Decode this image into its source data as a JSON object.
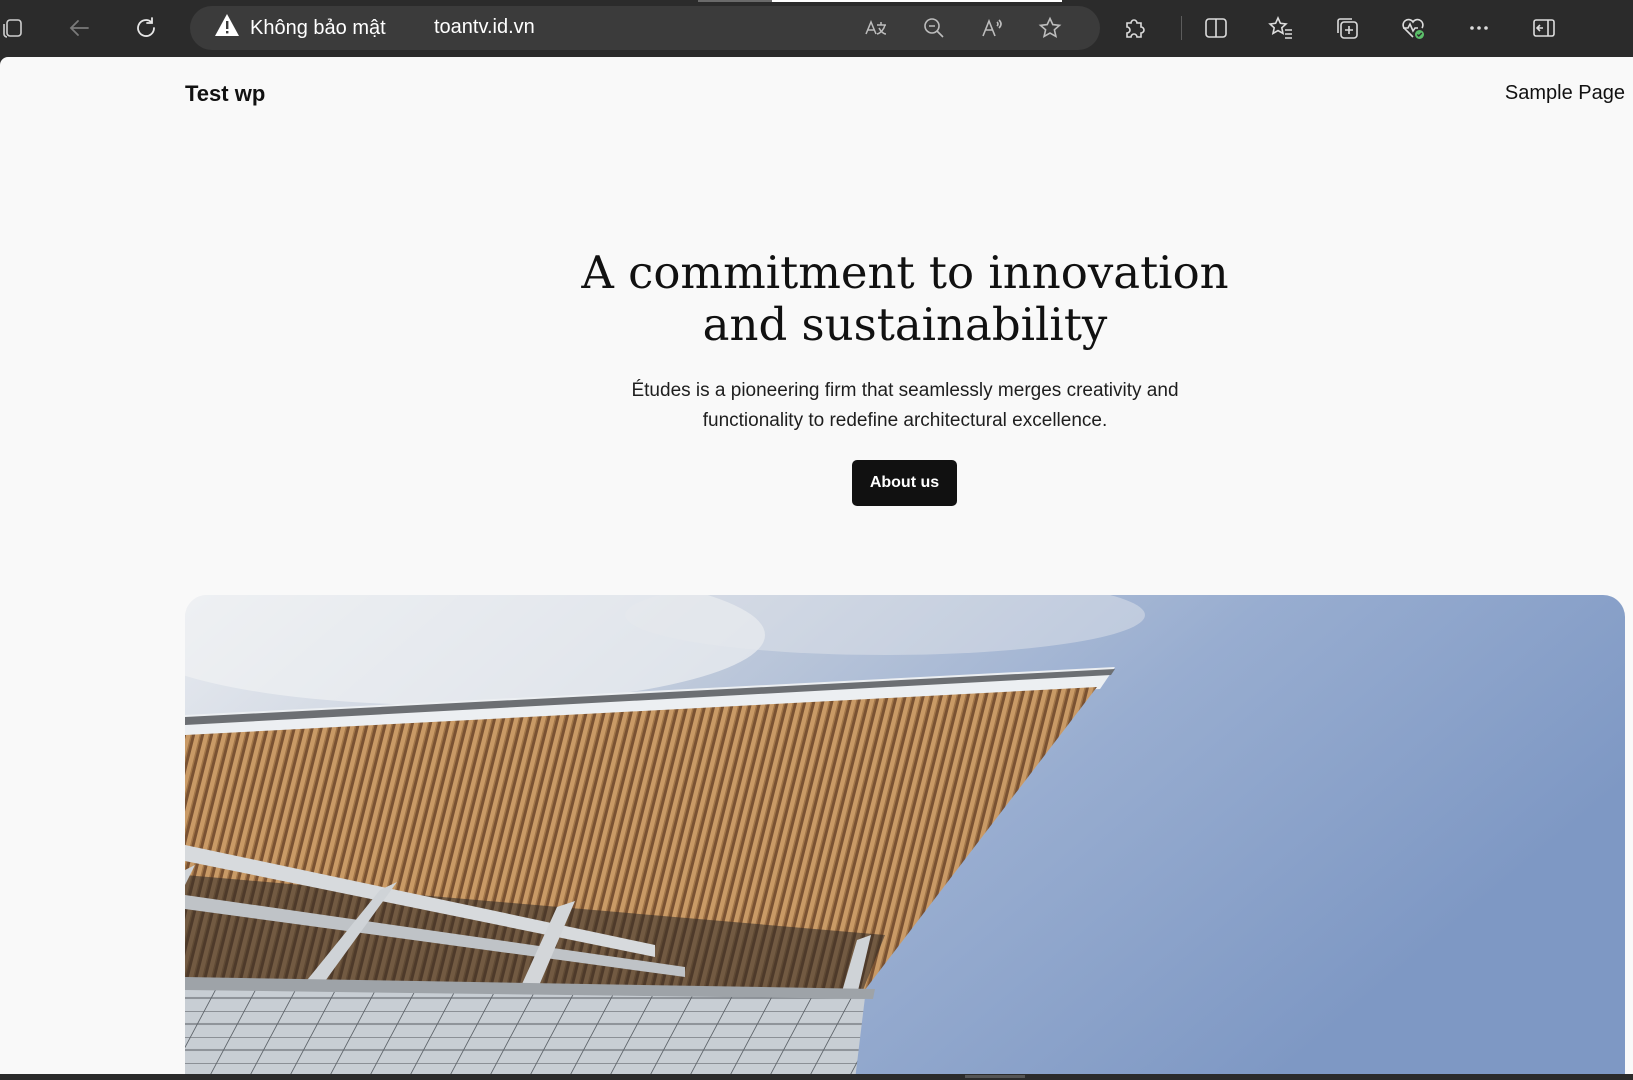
{
  "browser": {
    "security_label": "Không bảo mật",
    "url": "toantv.id.vn",
    "icons": {
      "workspaces": "workspaces-icon",
      "back": "back-arrow-icon",
      "refresh": "refresh-icon",
      "warning": "warning-triangle-icon",
      "translate": "translate-icon",
      "zoom": "zoom-out-icon",
      "read_aloud": "read-aloud-icon",
      "favorite": "star-icon",
      "extensions": "puzzle-icon",
      "split": "split-screen-icon",
      "favorites": "favorites-icon",
      "collections": "collections-icon",
      "health": "browser-essentials-icon",
      "more": "more-icon",
      "sidebar": "sidebar-toggle-icon"
    }
  },
  "site": {
    "title": "Test wp",
    "nav": [
      "Sample Page"
    ]
  },
  "hero": {
    "heading_line1": "A commitment to innovation",
    "heading_line2": "and sustainability",
    "text_line1": "Études is a pioneering firm that seamlessly merges creativity and",
    "text_line2": "functionality to redefine architectural excellence.",
    "button_label": "About us"
  },
  "colors": {
    "chrome_bg": "#2b2b2b",
    "address_bg": "#3b3b3b",
    "page_bg": "#f9f9f9",
    "button_bg": "#111111",
    "sky": "#8fa6cc",
    "health_badge": "#5bbf6a"
  }
}
